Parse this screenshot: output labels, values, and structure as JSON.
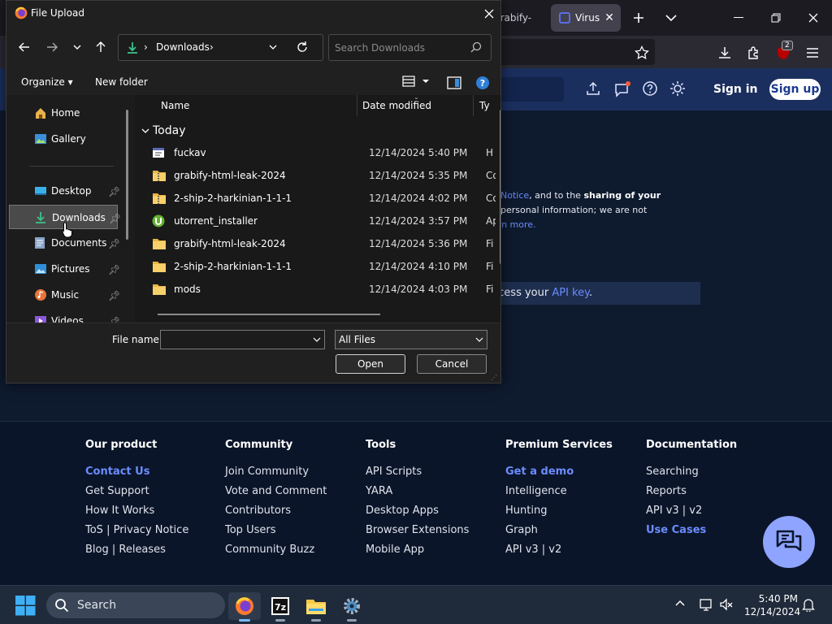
{
  "browser": {
    "tabs": [
      {
        "label": "grabify-"
      },
      {
        "label": "Virus"
      }
    ]
  },
  "site": {
    "sign_in": "Sign in",
    "sign_up": "Sign up",
    "privacy": {
      "part1": "y Notice",
      "part2": ", and to the ",
      "part3": "sharing of your",
      "part4": "y personal information; we are not",
      "part5": "arn more."
    },
    "api": {
      "prefix": "ccess your ",
      "link": "API key",
      "suffix": "."
    }
  },
  "footer": {
    "columns": [
      {
        "heading": "Our product",
        "links": [
          "Contact Us",
          "Get Support",
          "How It Works",
          "ToS | Privacy Notice",
          "Blog | Releases"
        ],
        "highlight": [
          0
        ]
      },
      {
        "heading": "Community",
        "links": [
          "Join Community",
          "Vote and Comment",
          "Contributors",
          "Top Users",
          "Community Buzz"
        ],
        "highlight": []
      },
      {
        "heading": "Tools",
        "links": [
          "API Scripts",
          "YARA",
          "Desktop Apps",
          "Browser Extensions",
          "Mobile App"
        ],
        "highlight": []
      },
      {
        "heading": "Premium Services",
        "links": [
          "Get a demo",
          "Intelligence",
          "Hunting",
          "Graph",
          "API v3 | v2"
        ],
        "highlight": [
          0
        ]
      },
      {
        "heading": "Documentation",
        "links": [
          "Searching",
          "Reports",
          "API v3 | v2",
          "Use Cases"
        ],
        "highlight": [
          3
        ]
      }
    ]
  },
  "dialog": {
    "title": "File Upload",
    "address": {
      "sep": "›",
      "path": "Downloads"
    },
    "search_placeholder": "Search Downloads",
    "toolbar": {
      "organize": "Organize ▾",
      "new_folder": "New folder"
    },
    "nav": [
      {
        "label": "Home",
        "icon": "home-icon"
      },
      {
        "label": "Gallery",
        "icon": "gallery-icon"
      },
      {
        "label": "Desktop",
        "icon": "desktop-icon",
        "pinned": true
      },
      {
        "label": "Downloads",
        "icon": "downloads-icon",
        "pinned": true,
        "selected": true
      },
      {
        "label": "Documents",
        "icon": "documents-icon",
        "pinned": true
      },
      {
        "label": "Pictures",
        "icon": "pictures-icon",
        "pinned": true
      },
      {
        "label": "Music",
        "icon": "music-icon",
        "pinned": true
      },
      {
        "label": "Videos",
        "icon": "videos-icon",
        "pinned": true
      }
    ],
    "columns": {
      "name": "Name",
      "date": "Date modified",
      "type": "Ty"
    },
    "group": "Today",
    "files": [
      {
        "name": "fuckav",
        "date": "12/14/2024 5:40 PM",
        "type": "H",
        "icon": "html-file-icon"
      },
      {
        "name": "grabify-html-leak-2024",
        "date": "12/14/2024 5:35 PM",
        "type": "Co",
        "icon": "zip-folder-icon"
      },
      {
        "name": "2-ship-2-harkinian-1-1-1",
        "date": "12/14/2024 4:02 PM",
        "type": "Co",
        "icon": "zip-folder-icon"
      },
      {
        "name": "utorrent_installer",
        "date": "12/14/2024 3:57 PM",
        "type": "Ap",
        "icon": "utorrent-icon"
      },
      {
        "name": "grabify-html-leak-2024",
        "date": "12/14/2024 5:36 PM",
        "type": "Fi",
        "icon": "folder-icon"
      },
      {
        "name": "2-ship-2-harkinian-1-1-1",
        "date": "12/14/2024 4:10 PM",
        "type": "Fi",
        "icon": "folder-icon"
      },
      {
        "name": "mods",
        "date": "12/14/2024 4:03 PM",
        "type": "Fi",
        "icon": "folder-icon"
      }
    ],
    "filename_label": "File name:",
    "filename_value": "",
    "filetype": "All Files",
    "open": "Open",
    "cancel": "Cancel"
  },
  "taskbar": {
    "search": "Search",
    "time": "5:40 PM",
    "date": "12/14/2024",
    "extension_badge": "2"
  },
  "colors": {
    "accent": "#6b8cff",
    "site_header": "#1b2f5e",
    "dialog_bg": "#202020"
  }
}
